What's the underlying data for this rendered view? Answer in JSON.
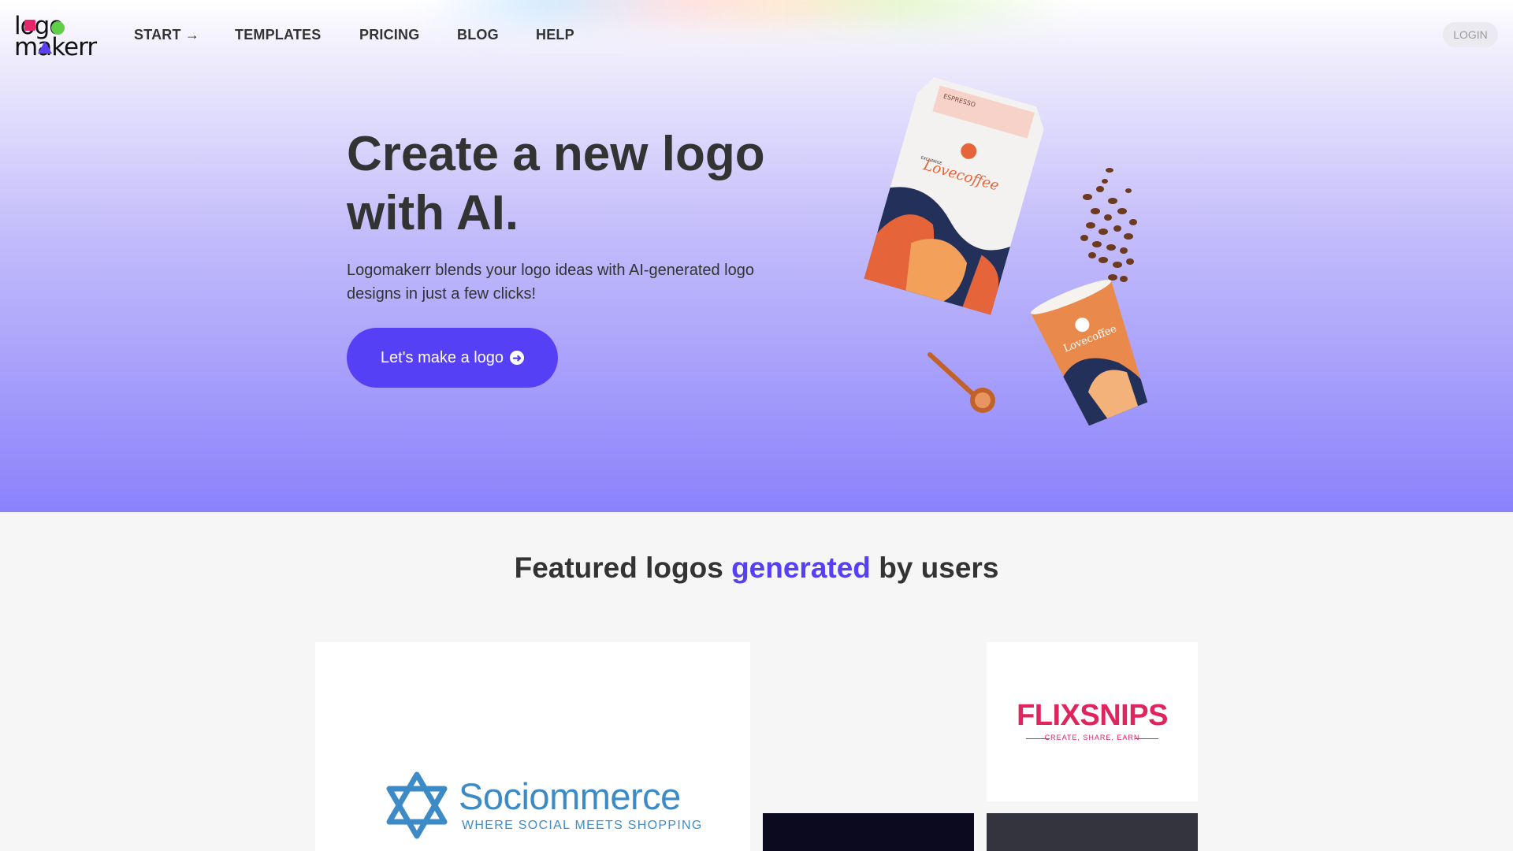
{
  "brand": {
    "line1": "logo",
    "line2": "makerr",
    "colors": {
      "square": "#e6266b",
      "circle": "#5fcf47",
      "triangle": "#5b3ff5"
    }
  },
  "nav": {
    "items": [
      {
        "label": "START →"
      },
      {
        "label": "TEMPLATES"
      },
      {
        "label": "PRICING"
      },
      {
        "label": "BLOG"
      },
      {
        "label": "HELP"
      }
    ],
    "login": "LOGIN"
  },
  "hero": {
    "title": "Create a new logo with AI.",
    "description": "Logomakerr blends your logo ideas with AI-generated logo designs in just a few clicks!",
    "cta": "Let's make a logo",
    "cta_icon": "arrow-circle-right-icon",
    "product": {
      "bag_label": "ESPRESSO",
      "bag_brand_small": "EXCHANGE",
      "bag_brand": "Lovecoffee",
      "cup_brand": "Lovecoffee"
    },
    "accent": "#5640f5"
  },
  "featured": {
    "heading_pre": "Featured logos ",
    "heading_highlight": "generated",
    "heading_post": " by users",
    "cards": [
      {
        "name": "Sociommerce",
        "tagline": "WHERE SOCIAL MEETS SHOPPING"
      },
      {
        "name": "FLIXSNIPS",
        "tagline": "CREATE, SHARE, EARN"
      }
    ]
  }
}
